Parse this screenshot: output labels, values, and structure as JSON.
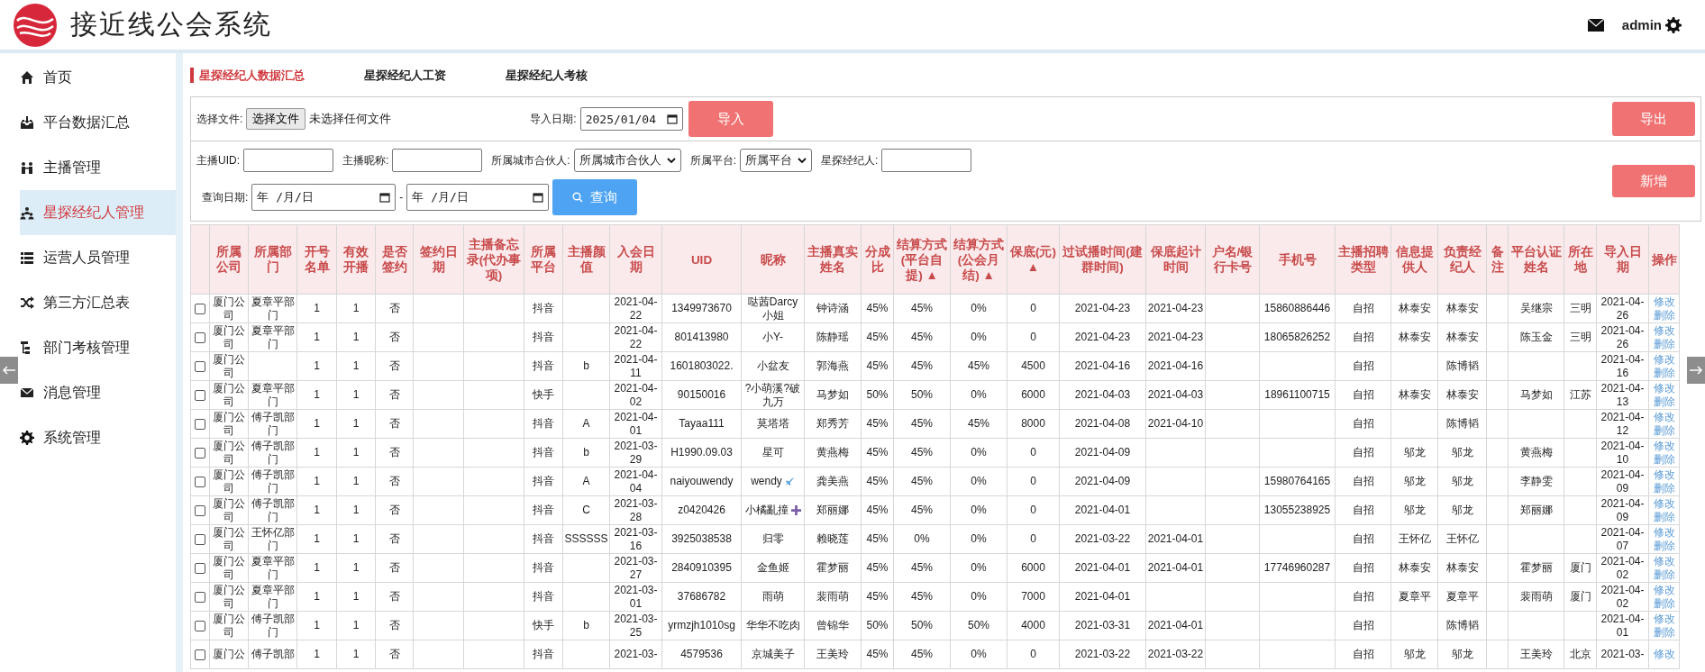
{
  "app": {
    "title": "接近线公会系统",
    "user": "admin"
  },
  "sidebar": {
    "items": [
      {
        "label": "首页",
        "selected": false
      },
      {
        "label": "平台数据汇总",
        "selected": false
      },
      {
        "label": "主播管理",
        "selected": false
      },
      {
        "label": "星探经纪人管理",
        "selected": true
      },
      {
        "label": "运营人员管理",
        "selected": false
      },
      {
        "label": "第三方汇总表",
        "selected": false
      },
      {
        "label": "部门考核管理",
        "selected": false
      },
      {
        "label": "消息管理",
        "selected": false
      },
      {
        "label": "系统管理",
        "selected": false
      }
    ]
  },
  "tabs": [
    {
      "label": "星探经纪人数据汇总",
      "selected": true
    },
    {
      "label": "星探经纪人工资",
      "selected": false
    },
    {
      "label": "星探经纪人考核",
      "selected": false
    }
  ],
  "import_bar": {
    "file_label": "选择文件:",
    "file_button": "选择文件",
    "file_status": "未选择任何文件",
    "date_label": "导入日期:",
    "date_value": "2025/01/04",
    "import_button": "导入",
    "export_button": "导出"
  },
  "filters": {
    "fields": [
      {
        "label": "主播UID:",
        "kind": "text"
      },
      {
        "label": "主播昵称:",
        "kind": "text"
      },
      {
        "label": "所属城市合伙人:",
        "kind": "select",
        "value": "所属城市合伙人"
      },
      {
        "label": "所属平台:",
        "kind": "select",
        "value": "所属平台"
      },
      {
        "label": "星探经纪人:",
        "kind": "text"
      }
    ],
    "date_label": "查询日期:",
    "date_from": "年 /月/日",
    "date_sep": "-",
    "date_to": "年 /月/日",
    "search_button": "查询",
    "add_button": "新增"
  },
  "table": {
    "columns": [
      {
        "label": "所属公司"
      },
      {
        "label": "所属部门"
      },
      {
        "label": "开号名单"
      },
      {
        "label": "有效开播"
      },
      {
        "label": "是否签约"
      },
      {
        "label": "签约日期"
      },
      {
        "label": "主播备忘录(代办事项)"
      },
      {
        "label": "所属平台"
      },
      {
        "label": "主播颜值"
      },
      {
        "label": "入会日期"
      },
      {
        "label": "UID"
      },
      {
        "label": "昵称"
      },
      {
        "label": "主播真实姓名"
      },
      {
        "label": "分成比"
      },
      {
        "label": "结算方式(平台自提)",
        "sort": "▲"
      },
      {
        "label": "结算方式(公会月结)",
        "sort": "▲"
      },
      {
        "label": "保底(元)",
        "sort": "▲"
      },
      {
        "label": "过试播时间(建群时间)"
      },
      {
        "label": "保底起计时间"
      },
      {
        "label": "户名/银行卡号"
      },
      {
        "label": "手机号"
      },
      {
        "label": "主播招聘类型"
      },
      {
        "label": "信息提供人"
      },
      {
        "label": "负责经纪人"
      },
      {
        "label": "备注"
      },
      {
        "label": "平台认证姓名"
      },
      {
        "label": "所在地"
      },
      {
        "label": "导入日期"
      },
      {
        "label": "操作"
      }
    ],
    "rows": [
      {
        "checked": false,
        "cells": [
          "厦门公司",
          "夏章平部门",
          "1",
          "1",
          "否",
          null,
          null,
          "抖音",
          null,
          "2021-04-22",
          "1349973670",
          "哒茜Darcy小姐",
          "钟诗涵",
          "45%",
          "45%",
          "0%",
          "0",
          "2021-04-23",
          "2021-04-23",
          null,
          "15860886446",
          "自招",
          "林泰安",
          "林泰安",
          null,
          "吴继宗",
          "三明",
          "2021-04-26"
        ],
        "actions": [
          "修改",
          "删除"
        ]
      },
      {
        "checked": false,
        "cells": [
          "厦门公司",
          "夏章平部门",
          "1",
          "1",
          "否",
          null,
          null,
          "抖音",
          null,
          "2021-04-22",
          "801413980",
          "小Y-",
          "陈静瑶",
          "45%",
          "45%",
          "0%",
          "0",
          "2021-04-23",
          "2021-04-23",
          null,
          "18065826252",
          "自招",
          "林泰安",
          "林泰安",
          null,
          "陈玉金",
          "三明",
          "2021-04-26"
        ],
        "actions": [
          "修改",
          "删除"
        ]
      },
      {
        "checked": false,
        "cells": [
          "厦门公司",
          null,
          "1",
          "1",
          "否",
          null,
          null,
          "抖音",
          "b",
          "2021-04-11",
          "1601803022.",
          "小盆友",
          "郭海燕",
          "45%",
          "45%",
          "45%",
          "4500",
          "2021-04-16",
          "2021-04-16",
          null,
          null,
          "自招",
          null,
          "陈博韬",
          null,
          null,
          null,
          "2021-04-16"
        ],
        "actions": [
          "修改",
          "删除"
        ]
      },
      {
        "checked": false,
        "cells": [
          "厦门公司",
          "夏章平部门",
          "1",
          "1",
          "否",
          null,
          null,
          "快手",
          null,
          "2021-04-02",
          "90150016",
          "?小萌溪?破九万",
          "马梦如",
          "50%",
          "50%",
          "0%",
          "6000",
          "2021-04-03",
          "2021-04-03",
          null,
          "18961100715",
          "自招",
          "林泰安",
          "林泰安",
          null,
          "马梦如",
          "江苏",
          "2021-04-13"
        ],
        "actions": [
          "修改",
          "删除"
        ]
      },
      {
        "checked": false,
        "cells": [
          "厦门公司",
          "傅子凯部门",
          "1",
          "1",
          "否",
          null,
          null,
          "抖音",
          "A",
          "2021-04-01",
          "Tayaa111",
          "莫塔塔",
          "郑秀芳",
          "45%",
          "45%",
          "45%",
          "8000",
          "2021-04-08",
          "2021-04-10",
          null,
          null,
          "自招",
          null,
          "陈博韬",
          null,
          null,
          null,
          "2021-04-12"
        ],
        "actions": [
          "修改",
          "删除"
        ]
      },
      {
        "checked": false,
        "cells": [
          "厦门公司",
          "傅子凯部门",
          "1",
          "1",
          "否",
          null,
          null,
          "抖音",
          "b",
          "2021-03-29",
          "H1990.09.03",
          "星可",
          "黄燕梅",
          "45%",
          "45%",
          "0%",
          "0",
          "2021-04-09",
          null,
          null,
          null,
          "自招",
          "邬龙",
          "邬龙",
          null,
          "黄燕梅",
          null,
          "2021-04-10"
        ],
        "actions": [
          "修改",
          "删除"
        ]
      },
      {
        "checked": false,
        "cells": [
          "厦门公司",
          "傅子凯部门",
          "1",
          "1",
          "否",
          null,
          null,
          "抖音",
          "A",
          "2021-04-04",
          "naiyouwendy",
          "wendy",
          "龚美燕",
          "45%",
          "45%",
          "0%",
          "0",
          "2021-04-09",
          null,
          null,
          "15980764165",
          "自招",
          "邬龙",
          "邬龙",
          null,
          "李静雯",
          null,
          "2021-04-09"
        ],
        "actions": [
          "修改",
          "删除"
        ]
      },
      {
        "checked": false,
        "cells": [
          "厦门公司",
          "傅子凯部门",
          "1",
          "1",
          "否",
          null,
          null,
          "抖音",
          "C",
          "2021-03-28",
          "z0420426",
          "小橘亂撞",
          "郑丽娜",
          "45%",
          "45%",
          "0%",
          "0",
          "2021-04-01",
          null,
          null,
          "13055238925",
          "自招",
          "邬龙",
          "邬龙",
          null,
          "郑丽娜",
          null,
          "2021-04-09"
        ],
        "actions": [
          "修改",
          "删除"
        ]
      },
      {
        "checked": false,
        "cells": [
          "厦门公司",
          "王怀亿部门",
          "1",
          "1",
          "否",
          null,
          null,
          "抖音",
          "SSSSSS",
          "2021-03-16",
          "3925038538",
          "归零",
          "赖晓莲",
          "45%",
          "0%",
          "0%",
          "0",
          "2021-03-22",
          "2021-04-01",
          null,
          null,
          "自招",
          "王怀亿",
          "王怀亿",
          null,
          null,
          null,
          "2021-04-07"
        ],
        "actions": [
          "修改",
          "删除"
        ]
      },
      {
        "checked": false,
        "cells": [
          "厦门公司",
          "夏章平部门",
          "1",
          "1",
          "否",
          null,
          null,
          "抖音",
          null,
          "2021-03-27",
          "2840910395",
          "金鱼姬",
          "霍梦丽",
          "45%",
          "45%",
          "0%",
          "6000",
          "2021-04-01",
          "2021-04-01",
          null,
          "17746960287",
          "自招",
          "林泰安",
          "林泰安",
          null,
          "霍梦丽",
          "厦门",
          "2021-04-02"
        ],
        "actions": [
          "修改",
          "删除"
        ]
      },
      {
        "checked": false,
        "cells": [
          "厦门公司",
          "夏章平部门",
          "1",
          "1",
          "否",
          null,
          null,
          "抖音",
          null,
          "2021-03-01",
          "37686782",
          "雨萌",
          "裴雨萌",
          "45%",
          "45%",
          "0%",
          "7000",
          "2021-04-01",
          null,
          null,
          null,
          "自招",
          "夏章平",
          "夏章平",
          null,
          "裴雨萌",
          "厦门",
          "2021-04-02"
        ],
        "actions": [
          "修改",
          "删除"
        ]
      },
      {
        "checked": false,
        "cells": [
          "厦门公司",
          "傅子凯部门",
          "1",
          "1",
          "否",
          null,
          null,
          "快手",
          "b",
          "2021-03-25",
          "yrmzjh1010sg",
          "华华不吃肉",
          "曾锦华",
          "50%",
          "50%",
          "50%",
          "4000",
          "2021-03-31",
          "2021-04-01",
          null,
          null,
          "自招",
          null,
          "陈博韬",
          null,
          null,
          null,
          "2021-04-01"
        ],
        "actions": [
          "修改",
          "删除"
        ]
      },
      {
        "checked": false,
        "cells": [
          "厦门公",
          "傅子凯部",
          "1",
          "1",
          "否",
          null,
          null,
          "抖音",
          null,
          "2021-03-",
          "4579536",
          "京城美子",
          "王美玲",
          "45%",
          "45%",
          "0%",
          "0",
          "2021-03-22",
          "2021-03-22",
          null,
          null,
          "自招",
          "邬龙",
          "邬龙",
          null,
          "王美玲",
          "北京",
          "2021-03-"
        ],
        "actions": [
          "修改"
        ]
      }
    ]
  }
}
